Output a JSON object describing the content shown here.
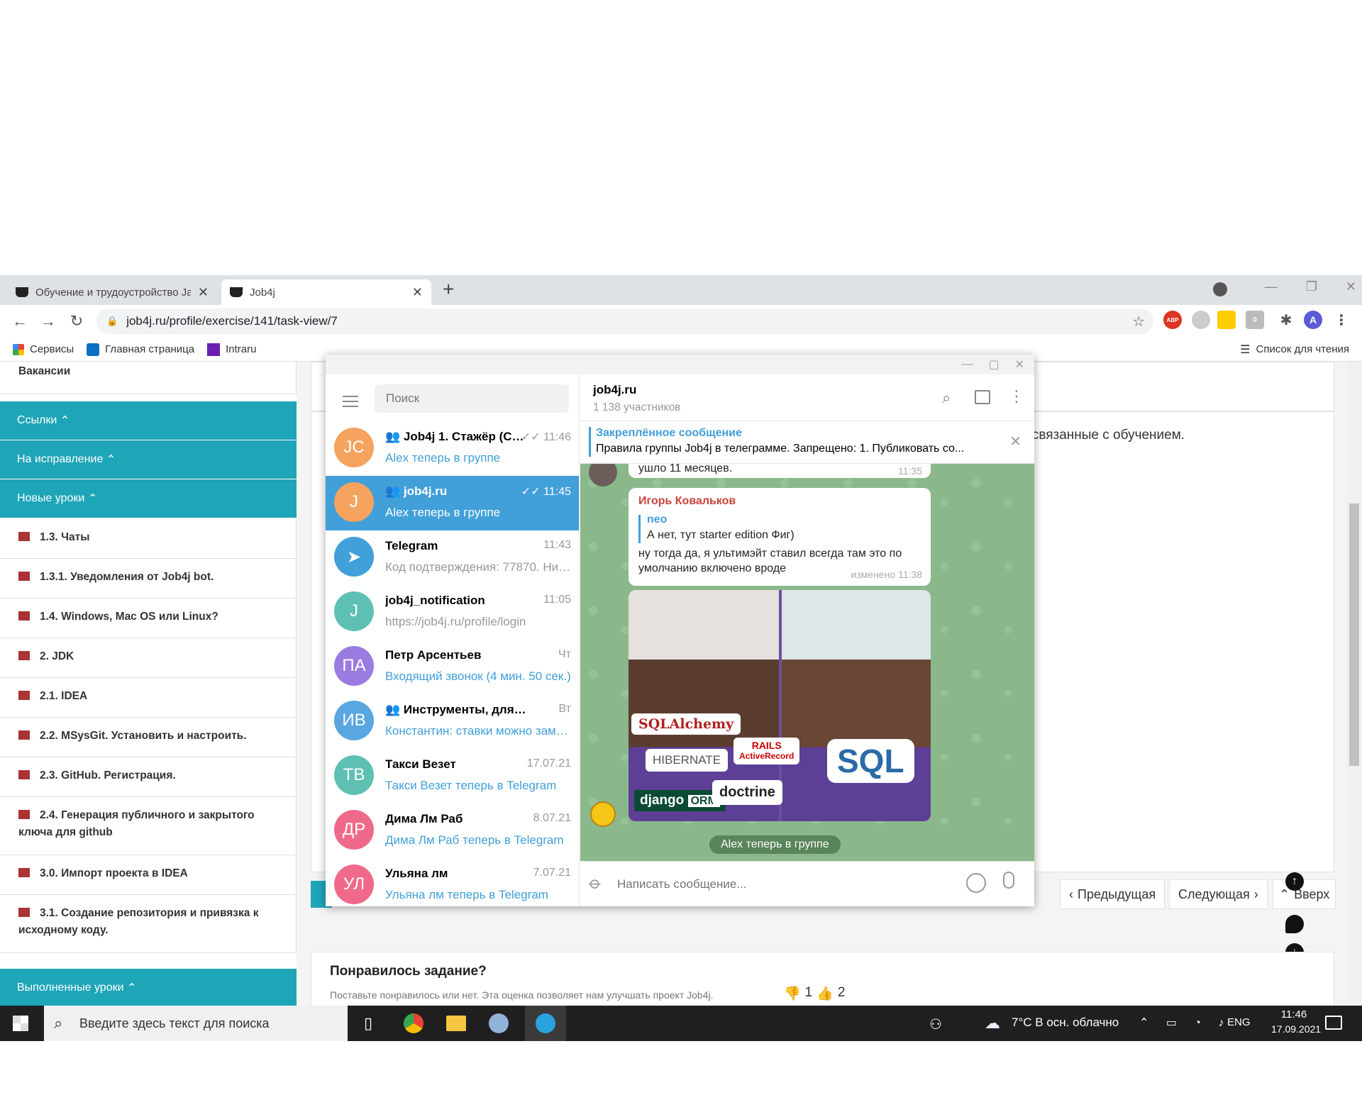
{
  "browser": {
    "tabs": [
      {
        "title": "Обучение и трудоустройство Ja"
      },
      {
        "title": "Job4j"
      }
    ],
    "url": "job4j.ru/profile/exercise/141/task-view/7",
    "profile_initial": "A",
    "abp_label": "ABP",
    "ext_badge": "0",
    "bookmarks": [
      "Сервисы",
      "Главная страница",
      "Intraru"
    ],
    "reading_list": "Список для чтения"
  },
  "sidebar": {
    "top_item": "Вакансии",
    "sections": [
      "Ссылки",
      "На исправление",
      "Новые уроки"
    ],
    "lessons": [
      "1.3. Чаты",
      "1.3.1. Уведомления от Job4j bot.",
      "1.4. Windows, Mac OS или Linux?",
      "2. JDK",
      "2.1. IDEA",
      "2.2. MSysGit. Установить и настроить.",
      "2.3. GitHub. Регистрация.",
      "2.4. Генерация публичного и закрытого ключа для github",
      "3.0. Импорт проекта в IDEA",
      "3.1. Создание репозитория и привязка к исходному коду."
    ],
    "done_section": "Выполненные уроки"
  },
  "content": {
    "visible_text": "е связанные с обучением.",
    "prev": "Предыдущая",
    "next": "Следующая",
    "up": "Вверх",
    "like_title": "Понравилось задание?",
    "like_sub": "Поставьте понравилось или нет. Эта оценка позволяет нам улучшать проект Job4j.",
    "dislikes": "1",
    "likes": "2"
  },
  "telegram": {
    "search_placeholder": "Поиск",
    "chats": [
      {
        "initials": "JC",
        "color": "#f5a35e",
        "name": "Job4j 1. Стажёр (Си...",
        "time": "11:46",
        "msg": "Alex теперь в группе",
        "group": true,
        "read": true
      },
      {
        "initials": "J",
        "color": "#f5a35e",
        "name": "job4j.ru",
        "time": "11:45",
        "msg": "Alex теперь в группе",
        "group": true,
        "read": true
      },
      {
        "initials": "",
        "color": "#419fd9",
        "name": "Telegram",
        "time": "11:43",
        "msg": "Код подтверждения: 77870. Ник..."
      },
      {
        "initials": "J",
        "color": "#5ec0b2",
        "name": "job4j_notification",
        "time": "11:05",
        "msg": "https://job4j.ru/profile/login"
      },
      {
        "initials": "ПА",
        "color": "#9a7be0",
        "name": "Петр Арсентьев",
        "time": "Чт",
        "msg": "Входящий звонок (4 мин. 50 сек.)"
      },
      {
        "initials": "ИВ",
        "color": "#5aa6e0",
        "name": "Инструменты, для обуч...",
        "time": "Вт",
        "msg": "Константин: ставки можно заму...",
        "group": true
      },
      {
        "initials": "ТВ",
        "color": "#5ec0b2",
        "name": "Такси Везет",
        "time": "17.07.21",
        "msg": "Такси Везет теперь в Telegram"
      },
      {
        "initials": "ДР",
        "color": "#ef6a8a",
        "name": "Дима Лм Раб",
        "time": "8.07.21",
        "msg": "Дима Лм Раб теперь в Telegram"
      },
      {
        "initials": "УЛ",
        "color": "#ef6a8a",
        "name": "Ульяна лм",
        "time": "7.07.21",
        "msg": "Ульяна лм теперь в Telegram"
      }
    ],
    "header": {
      "title": "job4j.ru",
      "members": "1 138 участников"
    },
    "pinned": {
      "label": "Закреплённое сообщение",
      "text": "Правила группы Job4j в телеграмме. Запрещено: 1. Публиковать со..."
    },
    "partial_msg": {
      "text": "ушло 11 месяцев.",
      "time": "11:35"
    },
    "message": {
      "author": "Игорь Ковальков",
      "reply_author": "neo",
      "reply_text": "А нет, тут starter edition Фиг)",
      "text": "ну тогда да, я ультимэйт ставил всегда там это по умолчанию включено вроде",
      "time": "изменено 11:38"
    },
    "image_labels": [
      "SQLAlchemy",
      "HIBERNATE",
      "RAILS",
      "ActiveRecord",
      "SQL",
      "django",
      "ORM",
      "doctrine"
    ],
    "service": "Alex теперь в группе",
    "compose_placeholder": "Написать сообщение..."
  },
  "taskbar": {
    "search": "Введите здесь текст для поиска",
    "weather": "7°C  В осн. облачно",
    "lang": "ENG",
    "time": "11:46",
    "date": "17.09.2021"
  }
}
